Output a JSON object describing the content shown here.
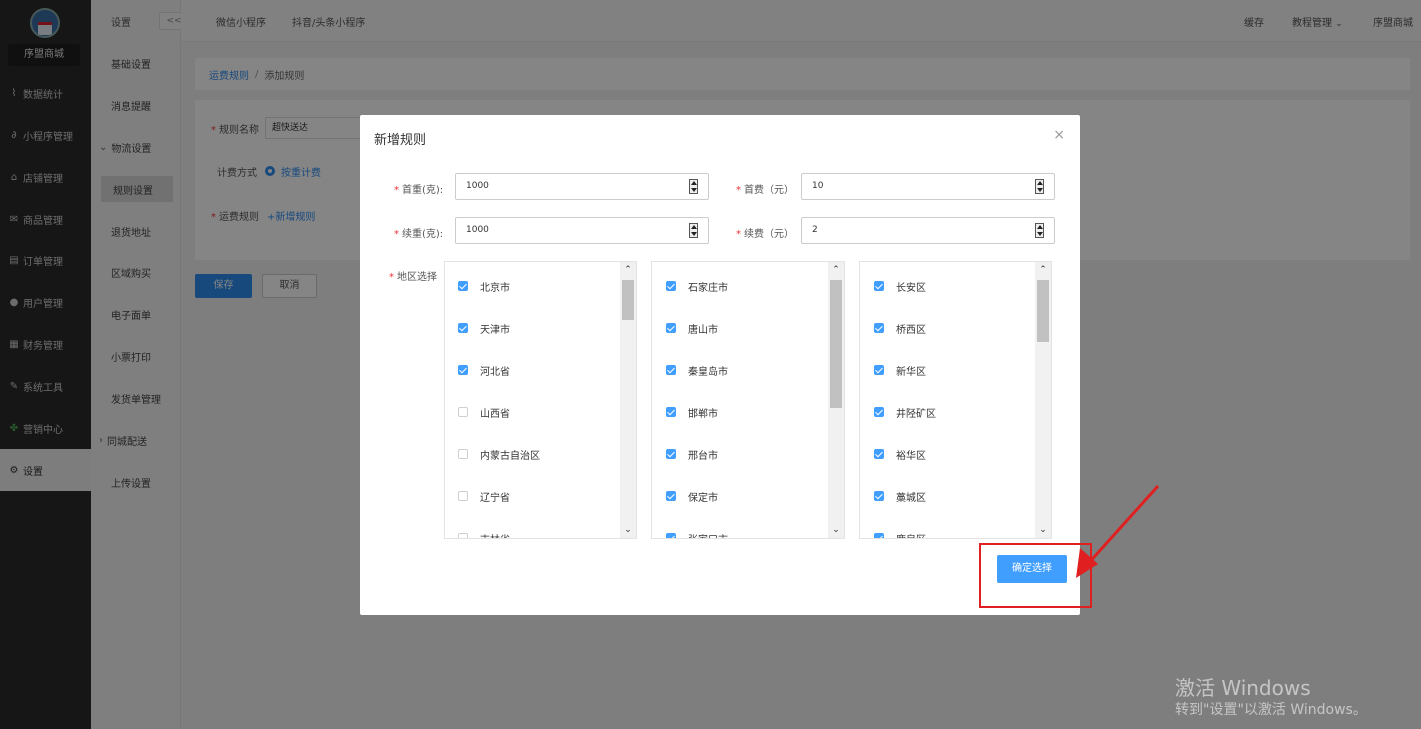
{
  "sidebar": {
    "shop_name": "序盟商城",
    "items": [
      {
        "label": "数据统计",
        "icon": "chart-icon"
      },
      {
        "label": "小程序管理",
        "icon": "link-icon"
      },
      {
        "label": "店铺管理",
        "icon": "store-icon"
      },
      {
        "label": "商品管理",
        "icon": "mail-icon"
      },
      {
        "label": "订单管理",
        "icon": "order-icon"
      },
      {
        "label": "用户管理",
        "icon": "user-icon"
      },
      {
        "label": "财务管理",
        "icon": "finance-icon"
      },
      {
        "label": "系统工具",
        "icon": "wrench-icon"
      },
      {
        "label": "营销中心",
        "icon": "marketing-icon"
      },
      {
        "label": "设置",
        "icon": "gear-icon"
      }
    ]
  },
  "subnav": {
    "title": "设置",
    "collapse_label": "<<",
    "items": [
      {
        "label": "基础设置"
      },
      {
        "label": "消息提醒"
      },
      {
        "label": "物流设置"
      },
      {
        "label": "规则设置"
      },
      {
        "label": "退货地址"
      },
      {
        "label": "区域购买"
      },
      {
        "label": "电子面单"
      },
      {
        "label": "小票打印"
      },
      {
        "label": "发货单管理"
      },
      {
        "label": "同城配送"
      },
      {
        "label": "上传设置"
      }
    ]
  },
  "topbar": {
    "tabs": [
      "微信小程序",
      "抖音/头条小程序"
    ],
    "right": [
      "缓存",
      "教程管理",
      "序盟商城"
    ]
  },
  "breadcrumb": {
    "parent": "运费规则",
    "separator": "/",
    "current": "添加规则"
  },
  "form": {
    "name_label": "规则名称",
    "name_value": "超快送达",
    "billing_label": "计费方式",
    "billing_option": "按重计费",
    "rules_label": "运费规则",
    "add_rule": "+新增规则",
    "save": "保存",
    "cancel": "取消"
  },
  "modal": {
    "title": "新增规则",
    "close": "×",
    "first_weight_label": "首重(克):",
    "first_weight_value": "1000",
    "first_fee_label": "首费（元）",
    "first_fee_value": "10",
    "extra_weight_label": "续重(克):",
    "extra_weight_value": "1000",
    "extra_fee_label": "续费（元）",
    "extra_fee_value": "2",
    "region_label": "地区选择",
    "provinces": [
      {
        "name": "北京市",
        "checked": true
      },
      {
        "name": "天津市",
        "checked": true
      },
      {
        "name": "河北省",
        "checked": true
      },
      {
        "name": "山西省",
        "checked": false
      },
      {
        "name": "内蒙古自治区",
        "checked": false
      },
      {
        "name": "辽宁省",
        "checked": false
      },
      {
        "name": "吉林省",
        "checked": false
      }
    ],
    "cities": [
      {
        "name": "石家庄市",
        "checked": true
      },
      {
        "name": "唐山市",
        "checked": true
      },
      {
        "name": "秦皇岛市",
        "checked": true
      },
      {
        "name": "邯郸市",
        "checked": true
      },
      {
        "name": "邢台市",
        "checked": true
      },
      {
        "name": "保定市",
        "checked": true
      },
      {
        "name": "张家口市",
        "checked": true
      }
    ],
    "districts": [
      {
        "name": "长安区",
        "checked": true
      },
      {
        "name": "桥西区",
        "checked": true
      },
      {
        "name": "新华区",
        "checked": true
      },
      {
        "name": "井陉矿区",
        "checked": true
      },
      {
        "name": "裕华区",
        "checked": true
      },
      {
        "name": "藁城区",
        "checked": true
      },
      {
        "name": "鹿泉区",
        "checked": true
      }
    ],
    "confirm": "确定选择"
  },
  "watermark": {
    "line1": "激活 Windows",
    "line2": "转到\"设置\"以激活 Windows。"
  },
  "colors": {
    "accent": "#409eff",
    "primary": "#2d8cf0",
    "highlight": "#e02020",
    "sidebar": "#2b2b2b"
  }
}
